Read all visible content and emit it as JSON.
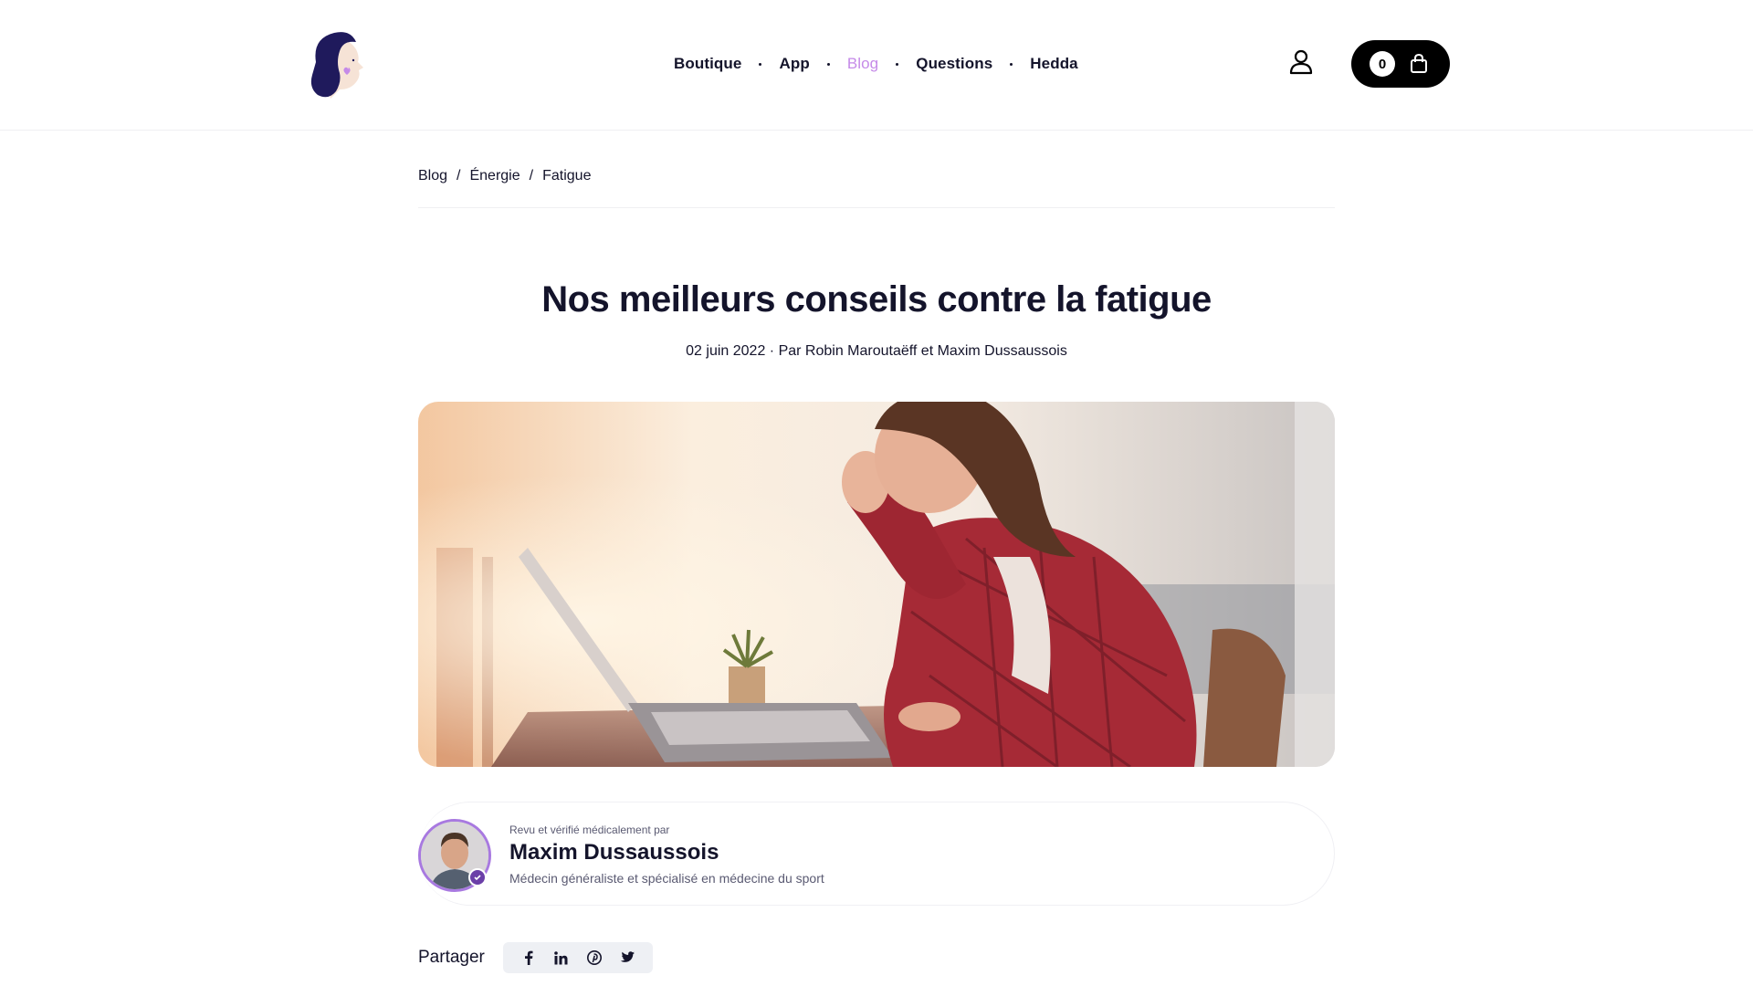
{
  "header": {
    "nav": [
      {
        "label": "Boutique"
      },
      {
        "label": "App"
      },
      {
        "label": "Blog",
        "active": true
      },
      {
        "label": "Questions"
      },
      {
        "label": "Hedda"
      }
    ],
    "cart_count": "0",
    "accent_color": "#c58ae8"
  },
  "breadcrumb": {
    "items": [
      "Blog",
      "Énergie",
      "Fatigue"
    ],
    "separator": "/"
  },
  "article": {
    "title": "Nos meilleurs conseils contre la fatigue",
    "meta": "02 juin 2022 · Par Robin Maroutaëff et Maxim Dussaussois"
  },
  "reviewer": {
    "label": "Revu et vérifié médicalement par",
    "name": "Maxim Dussaussois",
    "role": "Médecin généraliste et spécialisé en médecine du sport"
  },
  "share": {
    "label": "Partager",
    "icons": [
      "facebook-icon",
      "linkedin-icon",
      "pinterest-icon",
      "twitter-icon"
    ]
  }
}
